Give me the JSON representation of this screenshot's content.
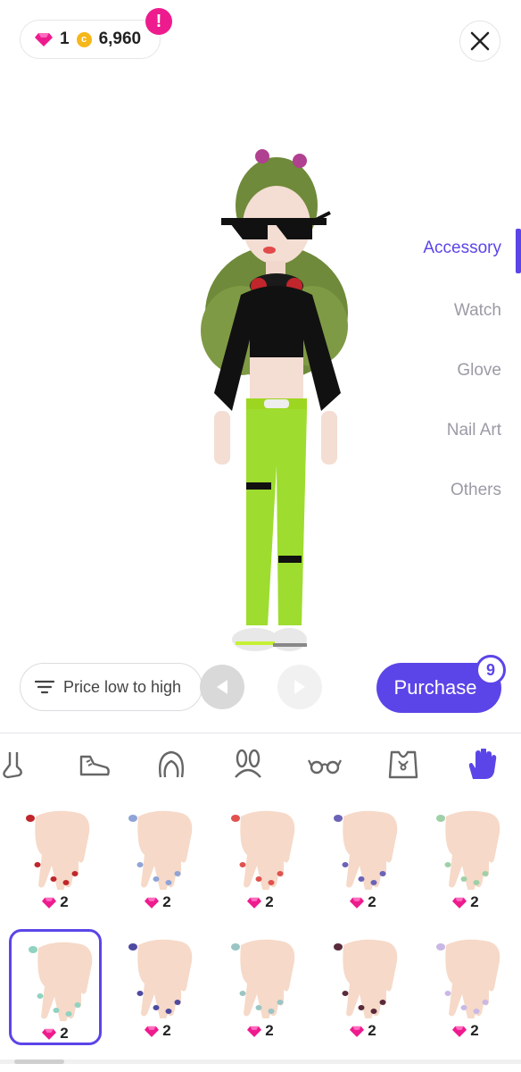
{
  "wallet": {
    "gems": "1",
    "coins": "6,960",
    "alert": "!"
  },
  "categories": [
    {
      "label": "Accessory",
      "active": true
    },
    {
      "label": "Watch",
      "active": false
    },
    {
      "label": "Glove",
      "active": false
    },
    {
      "label": "Nail Art",
      "active": false
    },
    {
      "label": "Others",
      "active": false
    }
  ],
  "controls": {
    "sort_label": "Price low to high",
    "purchase_label": "Purchase",
    "purchase_count": "9"
  },
  "icon_strip": [
    "sock-icon",
    "sneaker-icon",
    "hair-icon",
    "bunny-ears-icon",
    "glasses-icon",
    "necklace-icon",
    "glove-icon"
  ],
  "items": [
    {
      "price": "2",
      "nail": "#c0262b",
      "selected": false
    },
    {
      "price": "2",
      "nail": "#8fa4d6",
      "selected": false
    },
    {
      "price": "2",
      "nail": "#e0524f",
      "selected": false
    },
    {
      "price": "2",
      "nail": "#6a63b8",
      "selected": false
    },
    {
      "price": "2",
      "nail": "#9fd0a8",
      "selected": false
    },
    {
      "price": "2",
      "nail": "#8fd3c0",
      "selected": true
    },
    {
      "price": "2",
      "nail": "#4e4aa0",
      "selected": false
    },
    {
      "price": "2",
      "nail": "#9ac5c4",
      "selected": false
    },
    {
      "price": "2",
      "nail": "#5a2a3a",
      "selected": false
    },
    {
      "price": "2",
      "nail": "#c9b8e6",
      "selected": false
    }
  ],
  "colors": {
    "accent": "#5b45e8",
    "gem": "#ee1b8e",
    "coin": "#f5b71a"
  }
}
